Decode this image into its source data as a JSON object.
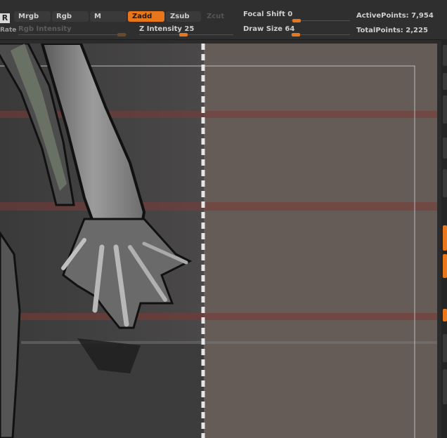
{
  "toolbar": {
    "brush_badge": "R",
    "rate_label": "Rate",
    "mrgb": "Mrgb",
    "rgb": "Rgb",
    "m": "M",
    "zadd": "Zadd",
    "zsub": "Zsub",
    "zcut": "Zcut",
    "rgb_intensity_label": "Rgb Intensity",
    "z_intensity_label": "Z Intensity",
    "z_intensity_value": "25",
    "focal_shift_label": "Focal Shift",
    "focal_shift_value": "0",
    "draw_size_label": "Draw Size",
    "draw_size_value": "64",
    "active_points_label": "ActivePoints:",
    "active_points_value": "7,954",
    "total_points_label": "TotalPoints:",
    "total_points_value": "2,225",
    "accent_color": "#e8761b"
  },
  "sliders": {
    "rgb_intensity": 0,
    "z_intensity": 0.25,
    "focal_shift": 0,
    "draw_size": 0.06
  }
}
